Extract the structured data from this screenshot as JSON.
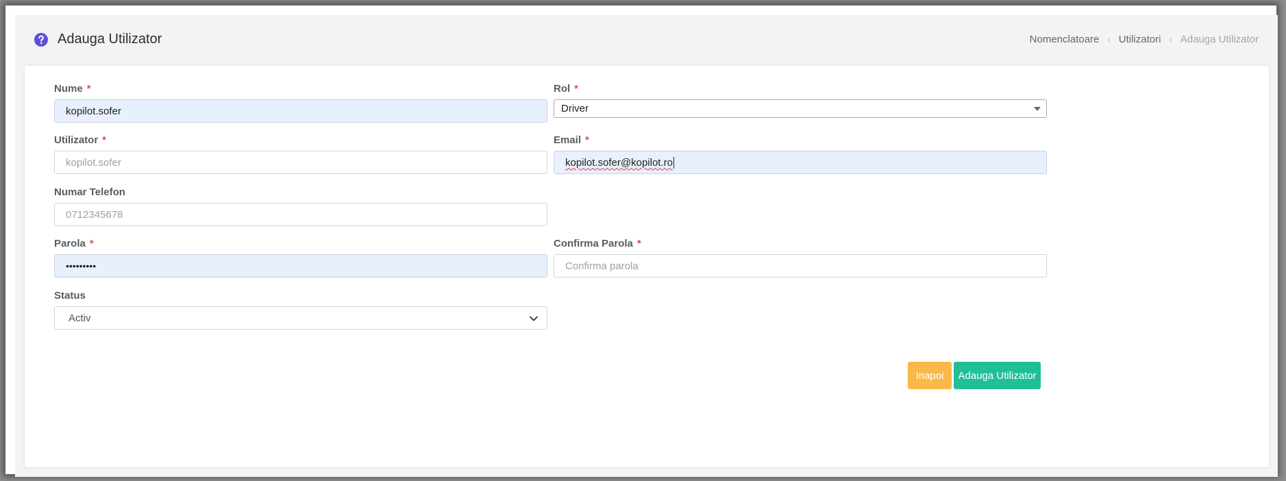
{
  "header": {
    "title": "Adauga Utilizator",
    "help_icon": "question-circle-icon",
    "breadcrumb": [
      "Nomenclatoare",
      "Utilizatori",
      "Adauga Utilizator"
    ]
  },
  "form": {
    "nume": {
      "label": "Nume",
      "required": "*",
      "value": "kopilot.sofer"
    },
    "rol": {
      "label": "Rol",
      "required": "*",
      "value": "Driver"
    },
    "utilizator": {
      "label": "Utilizator",
      "required": "*",
      "placeholder": "kopilot.sofer"
    },
    "email": {
      "label": "Email",
      "required": "*",
      "value": "kopilot.sofer@kopilot.ro"
    },
    "telefon": {
      "label": "Numar Telefon",
      "placeholder": "0712345678"
    },
    "parola": {
      "label": "Parola",
      "required": "*",
      "value": "•••••••••"
    },
    "confirma": {
      "label": "Confirma Parola",
      "required": "*",
      "placeholder": "Confirma parola"
    },
    "status": {
      "label": "Status",
      "value": "Activ"
    }
  },
  "actions": {
    "back_label": "Inapoi",
    "add_label": "Adauga Utilizator"
  },
  "colors": {
    "accent": "#5b4fd6",
    "back_button": "#f8b94a",
    "add_button": "#1fbf98",
    "required": "#e74a4a",
    "autofill": "#e8f0fd"
  }
}
